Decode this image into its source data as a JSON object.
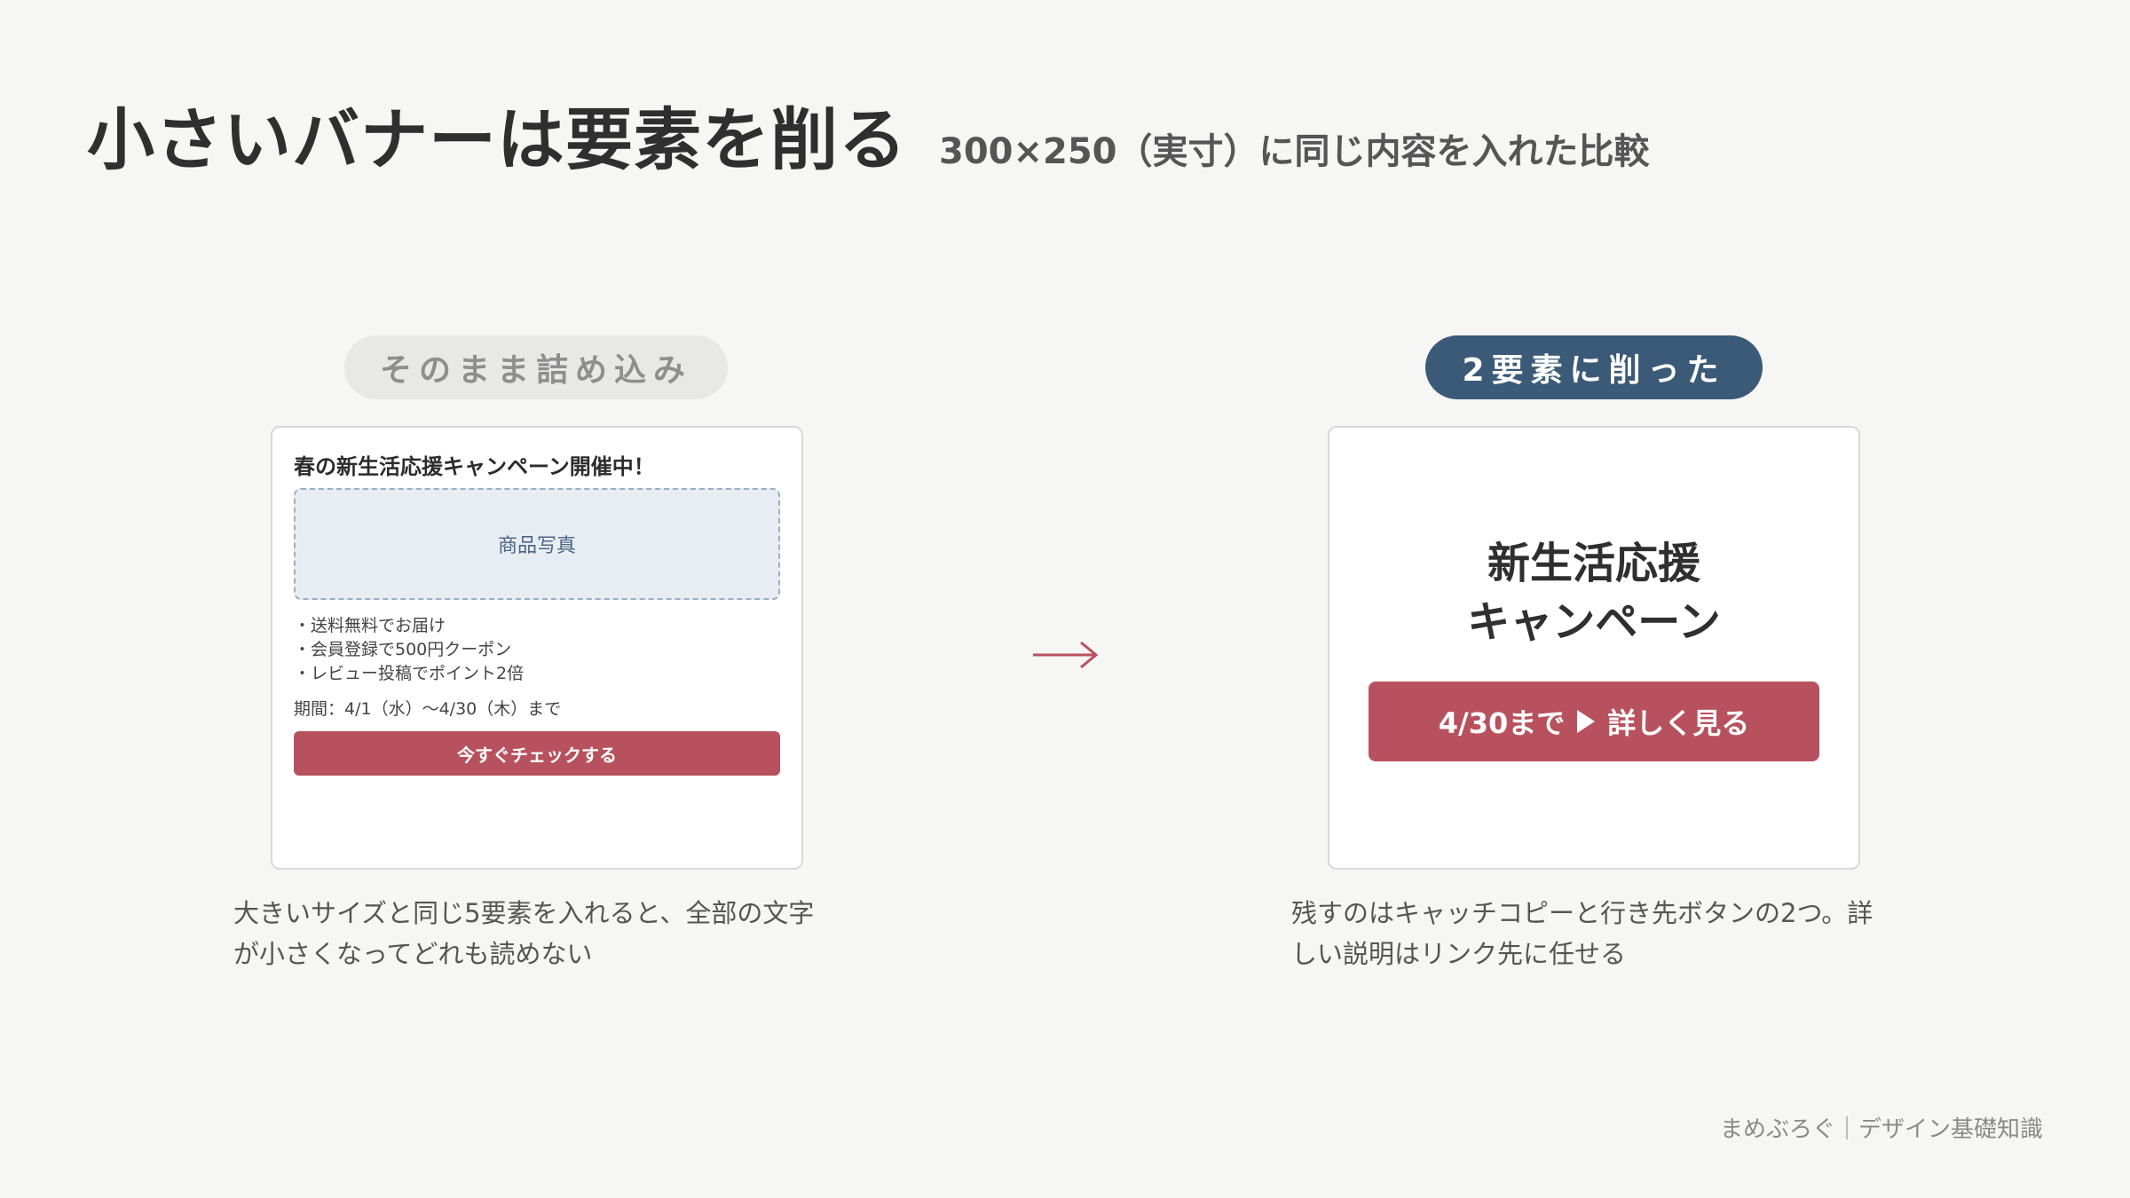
{
  "header": {
    "title": "小さいバナーは要素を削る",
    "subtitle": "300×250（実寸）に同じ内容を入れた比較"
  },
  "left": {
    "pill": "そのまま詰め込み",
    "banner": {
      "headline": "春の新生活応援キャンペーン開催中！",
      "photo_label": "商品写真",
      "bullets": [
        "・送料無料でお届け",
        "・会員登録で500円クーポン",
        "・レビュー投稿でポイント2倍"
      ],
      "period": "期間：4/1（水）〜4/30（木）まで",
      "button_label": "今すぐチェックする"
    },
    "caption_lines": [
      "大きいサイズと同じ5要素を入れると、全部の文字",
      "が小さくなってどれも読めない"
    ]
  },
  "right": {
    "pill": "2要素に削った",
    "banner": {
      "copy_lines": [
        "新生活応援",
        "キャンペーン"
      ],
      "button_text_before": "4/30まで",
      "button_text_after": "詳しく見る"
    },
    "caption_lines": [
      "残すのはキャッチコピーと行き先ボタンの2つ。詳",
      "しい説明はリンク先に任せる"
    ]
  },
  "footer": "まめぶろぐ｜デザイン基礎知識",
  "colors": {
    "background": "#f6f6f4",
    "accent_red": "#b8515e",
    "navy": "#3a5a78",
    "photo_fill": "#e8edf4"
  },
  "icons": {
    "arrow": "right-arrow-icon",
    "play": "play-triangle-icon"
  }
}
